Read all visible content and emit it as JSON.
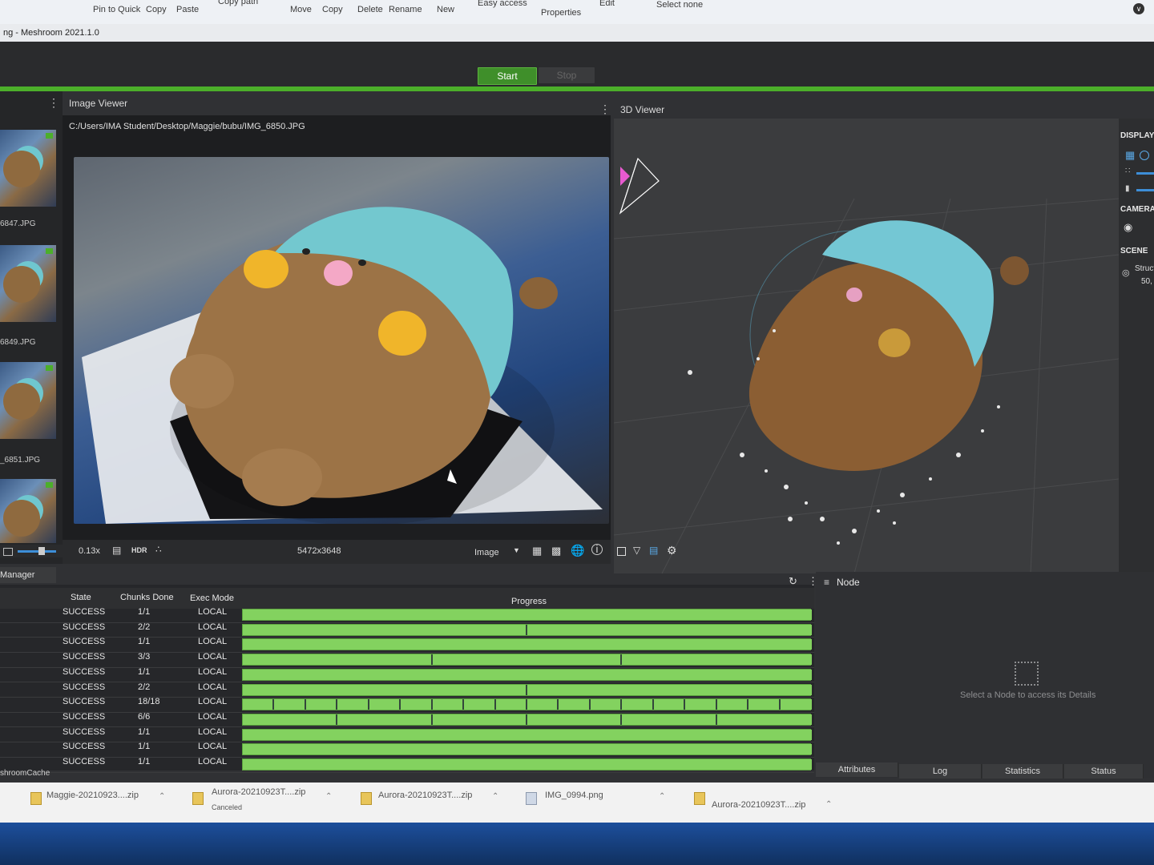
{
  "explorer_ribbon": {
    "items": [
      "Pin to Quick",
      "Copy",
      "Paste",
      "Copy path",
      "Move",
      "Copy",
      "Delete",
      "Rename",
      "New",
      "Easy access",
      "Properties",
      "Edit",
      "Select none"
    ]
  },
  "window": {
    "title": "ng - Meshroom 2021.1.0"
  },
  "toolbar": {
    "start_label": "Start",
    "stop_label": "Stop"
  },
  "thumbnails": [
    "6847.JPG",
    "6849.JPG",
    "_6851.JPG",
    ""
  ],
  "image_viewer": {
    "title": "Image Viewer",
    "path": "C:/Users/IMA Student/Desktop/Maggie/bubu/IMG_6850.JPG",
    "zoom": "0.13x",
    "hdr_label": "HDR",
    "resolution": "5472x3648",
    "mode_label": "Image"
  },
  "viewer_3d": {
    "title": "3D Viewer"
  },
  "display_panel": {
    "display_label": "DISPLAY",
    "camera_label": "CAMERA",
    "scene_label": "SCENE",
    "scene_item": "Struct",
    "scene_count": "50,"
  },
  "task_manager": {
    "tab_label": "Manager",
    "headers": {
      "state": "State",
      "chunks": "Chunks Done",
      "exec": "Exec Mode",
      "progress": "Progress"
    },
    "rows": [
      {
        "state": "SUCCESS",
        "chunks": "1/1",
        "exec": "LOCAL",
        "n": 1
      },
      {
        "state": "SUCCESS",
        "chunks": "2/2",
        "exec": "LOCAL",
        "n": 2
      },
      {
        "state": "SUCCESS",
        "chunks": "1/1",
        "exec": "LOCAL",
        "n": 1
      },
      {
        "state": "SUCCESS",
        "chunks": "3/3",
        "exec": "LOCAL",
        "n": 3
      },
      {
        "state": "SUCCESS",
        "chunks": "1/1",
        "exec": "LOCAL",
        "n": 1
      },
      {
        "state": "SUCCESS",
        "chunks": "2/2",
        "exec": "LOCAL",
        "n": 2
      },
      {
        "state": "SUCCESS",
        "chunks": "18/18",
        "exec": "LOCAL",
        "n": 18
      },
      {
        "state": "SUCCESS",
        "chunks": "6/6",
        "exec": "LOCAL",
        "n": 6
      },
      {
        "state": "SUCCESS",
        "chunks": "1/1",
        "exec": "LOCAL",
        "n": 1
      },
      {
        "state": "SUCCESS",
        "chunks": "1/1",
        "exec": "LOCAL",
        "n": 1
      },
      {
        "state": "SUCCESS",
        "chunks": "1/1",
        "exec": "LOCAL",
        "n": 1
      }
    ],
    "cache_label": "shroomCache"
  },
  "node_panel": {
    "title": "Node",
    "empty_message": "Select a Node to access its Details",
    "tabs": [
      "Attributes",
      "Log",
      "Statistics",
      "Status"
    ]
  },
  "downloads": [
    {
      "name": "Maggie-20210923....zip",
      "sub": ""
    },
    {
      "name": "Aurora-20210923T....zip",
      "sub": "Canceled"
    },
    {
      "name": "Aurora-20210923T....zip",
      "sub": ""
    },
    {
      "name": "IMG_0994.png",
      "sub": ""
    },
    {
      "name": "Aurora-20210923T....zip",
      "sub": ""
    }
  ],
  "colors": {
    "accent_green": "#4caf2a",
    "progress_green": "#83d25f",
    "panel_bg": "#303134"
  }
}
